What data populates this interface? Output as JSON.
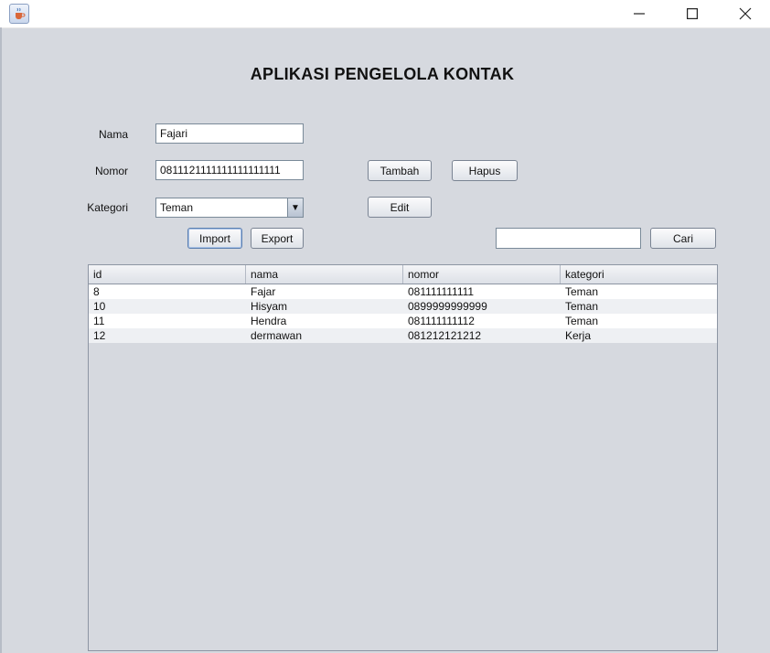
{
  "window": {
    "minimize_glyph": "—",
    "maximize_glyph": "☐",
    "close_glyph": "✕",
    "icon": "java-cup-icon"
  },
  "form": {
    "title": "APLIKASI PENGELOLA KONTAK",
    "nama_label": "Nama",
    "nama_value": "Fajari",
    "nomor_label": "Nomor",
    "nomor_value": "0811121111111111111111",
    "kategori_label": "Kategori",
    "kategori_value": "Teman",
    "search_value": ""
  },
  "buttons": {
    "tambah": "Tambah",
    "hapus": "Hapus",
    "edit": "Edit",
    "import": "Import",
    "export": "Export",
    "cari": "Cari"
  },
  "table": {
    "columns": [
      "id",
      "nama",
      "nomor",
      "kategori"
    ],
    "rows": [
      [
        "8",
        "Fajar",
        "081111111111",
        "Teman"
      ],
      [
        "10",
        "Hisyam",
        "0899999999999",
        "Teman"
      ],
      [
        "11",
        "Hendra",
        "081111111112",
        "Teman"
      ],
      [
        "12",
        "dermawan",
        "081212121212",
        "Kerja"
      ]
    ]
  }
}
